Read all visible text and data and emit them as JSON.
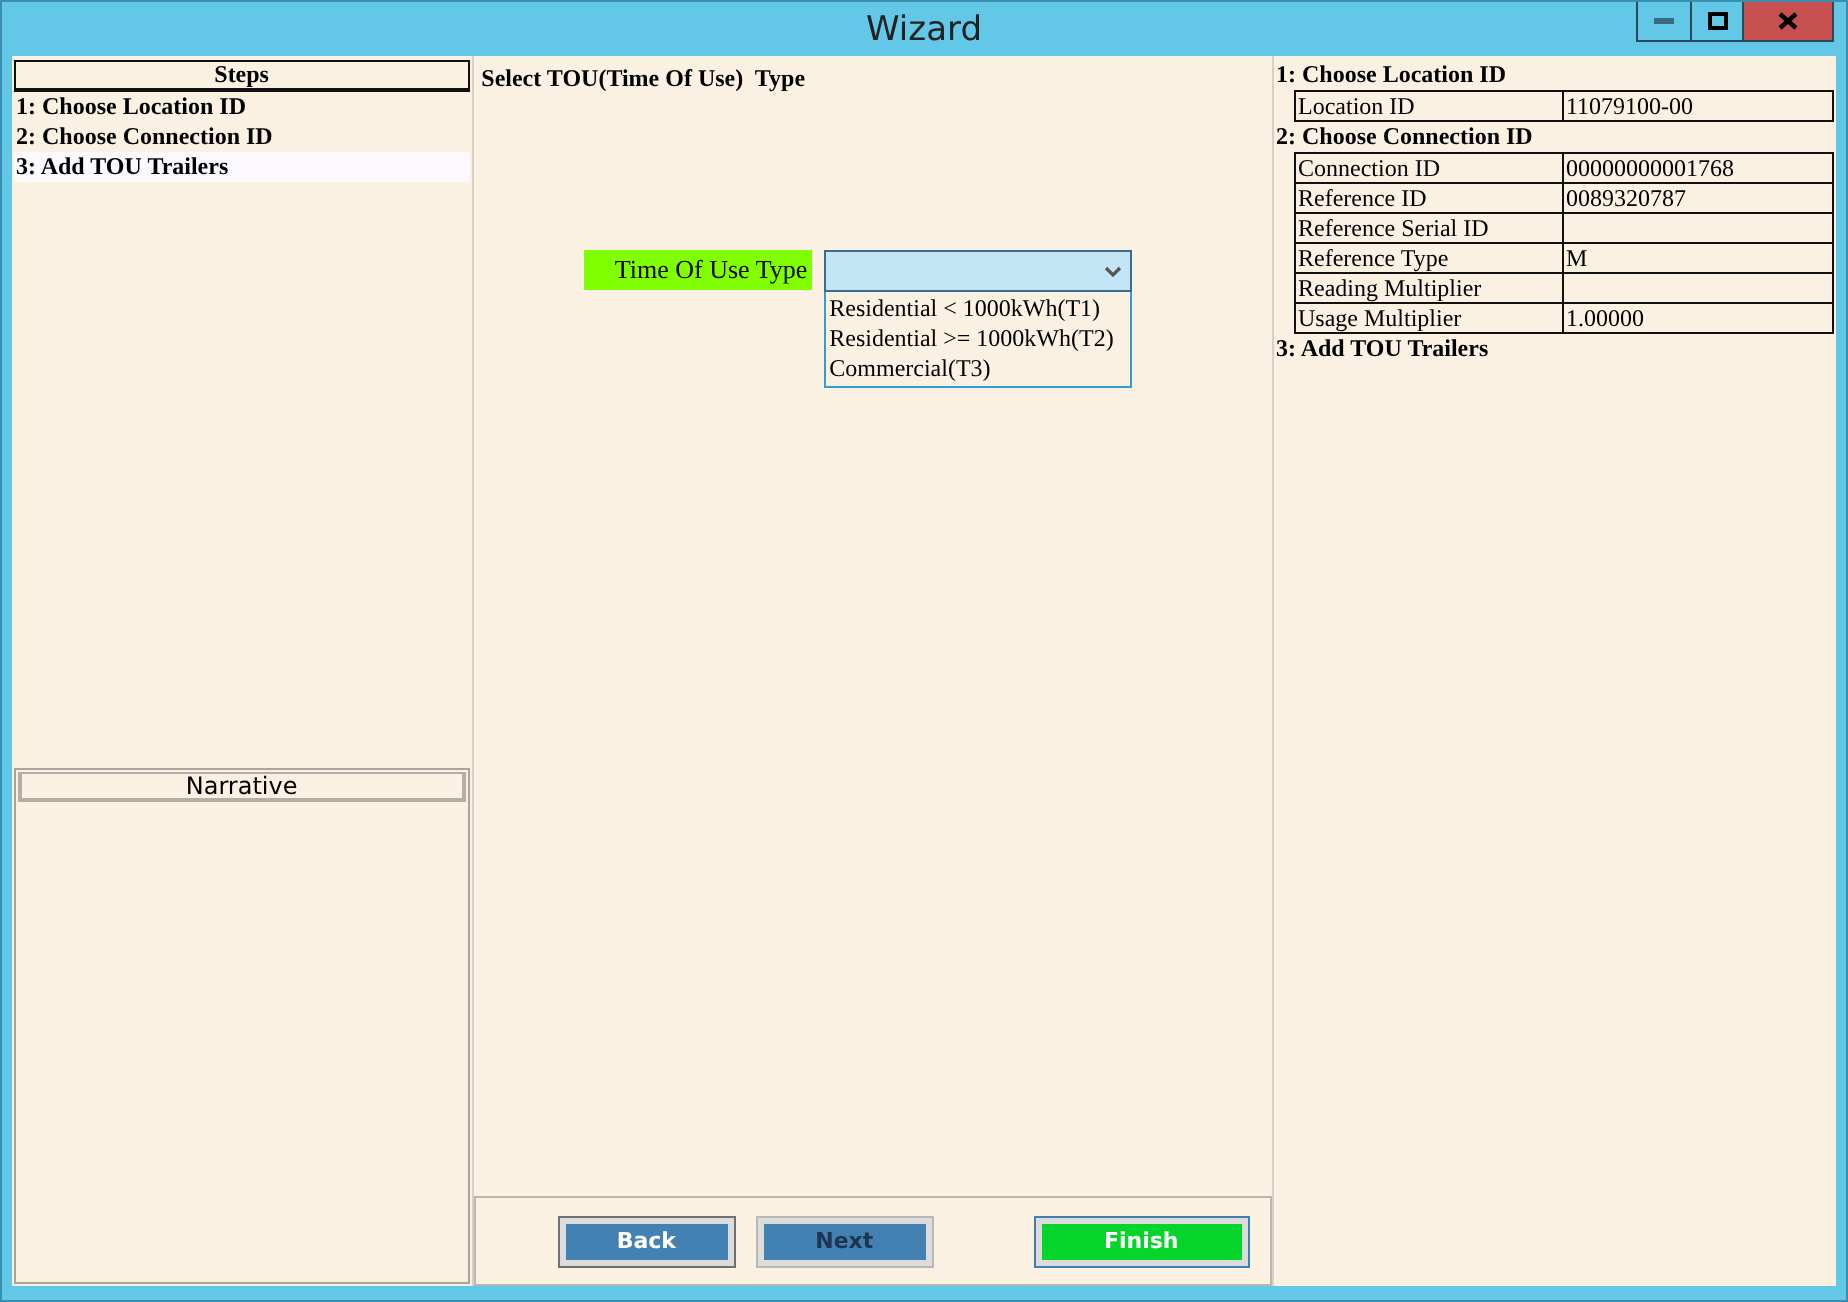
{
  "window": {
    "title": "Wizard"
  },
  "steps": {
    "heading": "Steps",
    "items": [
      {
        "label": "1: Choose Location ID",
        "selected": false
      },
      {
        "label": "2: Choose Connection ID",
        "selected": false
      },
      {
        "label": "3: Add TOU Trailers",
        "selected": true
      }
    ]
  },
  "narrative": {
    "heading": "Narrative"
  },
  "main": {
    "heading": "Select TOU(Time Of Use)  Type",
    "field": {
      "label": "Time Of Use Type",
      "expanded": true,
      "options": [
        "Residential < 1000kWh(T1)",
        "Residential >= 1000kWh(T2)",
        "Commercial(T3)"
      ]
    }
  },
  "buttons": [
    {
      "label": "Back",
      "kind": "normal",
      "disabled": false
    },
    {
      "label": "Next",
      "kind": "normal",
      "disabled": true
    },
    {
      "label": "Finish",
      "kind": "primary",
      "disabled": false
    }
  ],
  "summary": [
    {
      "heading": "1: Choose Location ID",
      "rows": [
        [
          "Location ID",
          "11079100-00"
        ]
      ]
    },
    {
      "heading": "2: Choose Connection ID",
      "rows": [
        [
          "Connection ID",
          "00000000001768"
        ],
        [
          "Reference ID",
          "0089320787"
        ],
        [
          "Reference Serial ID",
          ""
        ],
        [
          "Reference Type",
          "M"
        ],
        [
          "Reading Multiplier",
          ""
        ],
        [
          "Usage Multiplier",
          "1.00000"
        ]
      ]
    },
    {
      "heading": "3: Add TOU Trailers"
    }
  ]
}
